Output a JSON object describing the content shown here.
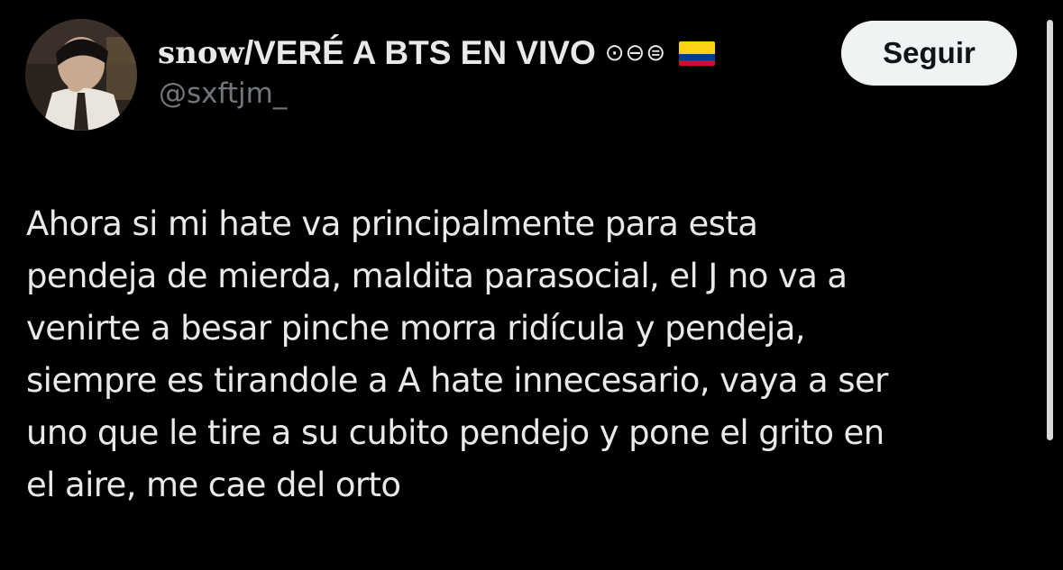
{
  "user": {
    "display_name_first": "snow",
    "display_name_rest": "/VERÉ A BTS EN VIVO",
    "display_name_symbols": "⊙⊖⊜",
    "flag_icon": "colombia-flag-icon",
    "handle": "@sxftjm_"
  },
  "follow_button": {
    "label": "Seguir"
  },
  "tweet": {
    "lines": [
      "Ahora si mi hate va principalmente para esta",
      "pendeja de mierda, maldita parasocial, el J no va a",
      "venirte a besar pinche morra ridícula y pendeja,",
      "siempre es tirandole a A hate innecesario, vaya a ser",
      "uno que le tire a su cubito pendejo y pone el grito en",
      "el aire, me cae del orto"
    ]
  },
  "colors": {
    "background": "#000000",
    "text_primary": "#e7e9ea",
    "text_secondary": "#71767b",
    "button_bg": "#eff3f4",
    "button_text": "#0f1419"
  }
}
